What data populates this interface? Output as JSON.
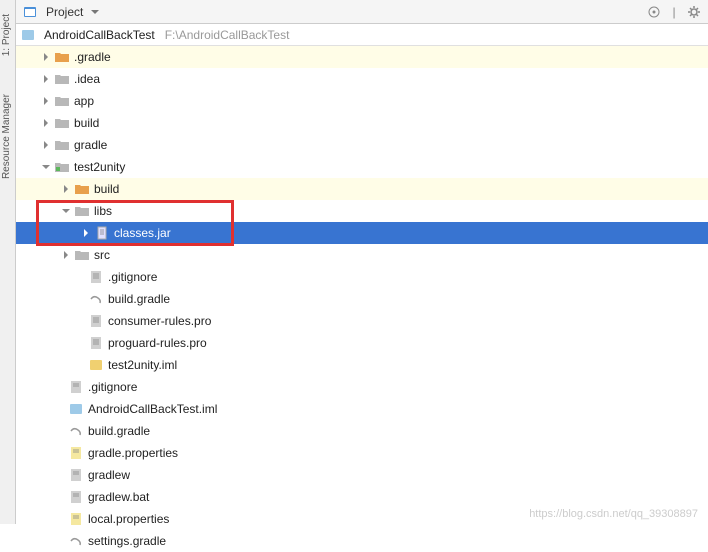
{
  "header": {
    "view_label": "Project"
  },
  "root": {
    "name": "AndroidCallBackTest",
    "path": "F:\\AndroidCallBackTest"
  },
  "tree": {
    "gradle_folder": ".gradle",
    "idea_folder": ".idea",
    "app_folder": "app",
    "build_folder": "build",
    "gradle_dir": "gradle",
    "test2unity": "test2unity",
    "t2_build": "build",
    "t2_libs": "libs",
    "t2_classes_jar": "classes.jar",
    "t2_src": "src",
    "t2_gitignore": ".gitignore",
    "t2_build_gradle": "build.gradle",
    "t2_consumer_rules": "consumer-rules.pro",
    "t2_proguard_rules": "proguard-rules.pro",
    "t2_iml": "test2unity.iml",
    "root_gitignore": ".gitignore",
    "root_iml": "AndroidCallBackTest.iml",
    "root_build_gradle": "build.gradle",
    "root_gradle_props": "gradle.properties",
    "root_gradlew": "gradlew",
    "root_gradlew_bat": "gradlew.bat",
    "root_local_props": "local.properties",
    "root_settings_gradle": "settings.gradle"
  },
  "sidebar": {
    "tab1": "1: Project",
    "tab2": "Resource Manager"
  },
  "watermark": "https://blog.csdn.net/qq_39308897"
}
